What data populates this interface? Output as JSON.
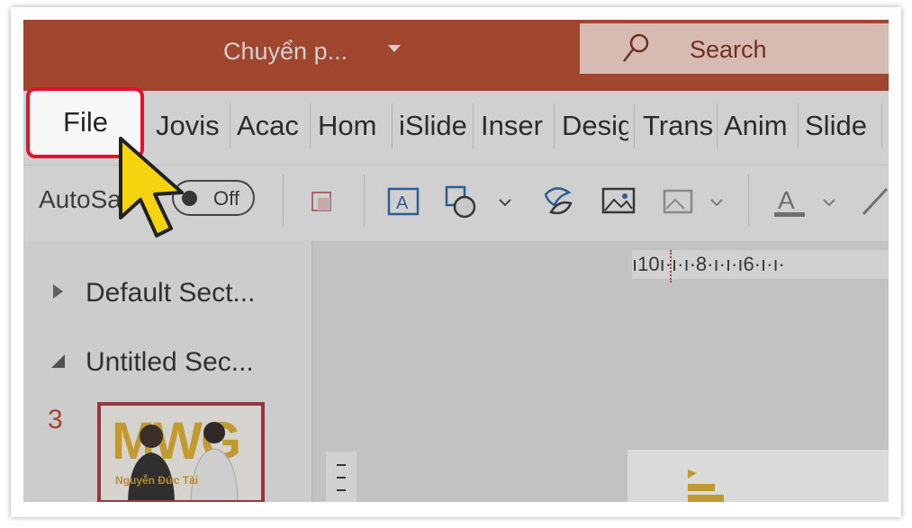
{
  "app": {
    "title": "Chuyển p...",
    "search_label": "Search"
  },
  "tabs": {
    "file": "File",
    "items": [
      "Jovis",
      "Acac",
      "Hom",
      "iSlide",
      "Inser",
      "Design",
      "Transitions",
      "Anim",
      "Slide"
    ]
  },
  "ribbon": {
    "autosave_label": "AutoSave",
    "toggle_state": "Off",
    "icons": [
      "format-shape-icon",
      "textbox-icon",
      "shapes-icon",
      "icons-icon",
      "picture-icon",
      "alt-picture-icon",
      "font-color-icon",
      "pen-icon"
    ]
  },
  "slides_panel": {
    "sections": [
      {
        "label": "Default Sect...",
        "state": "collapsed"
      },
      {
        "label": "Untitled Sec...",
        "state": "expanded"
      }
    ],
    "slide_number": "3",
    "thumbnail_text": "MWG",
    "thumbnail_caption": "Nguyễn Đức Tài"
  },
  "ruler": {
    "text": "ı10ı·ı·ı·8·ı·ı·ı6·ı·ı·"
  },
  "colors": {
    "titlebar": "#b7472a",
    "highlight": "#e8102a",
    "cursor": "#f5d40f"
  }
}
